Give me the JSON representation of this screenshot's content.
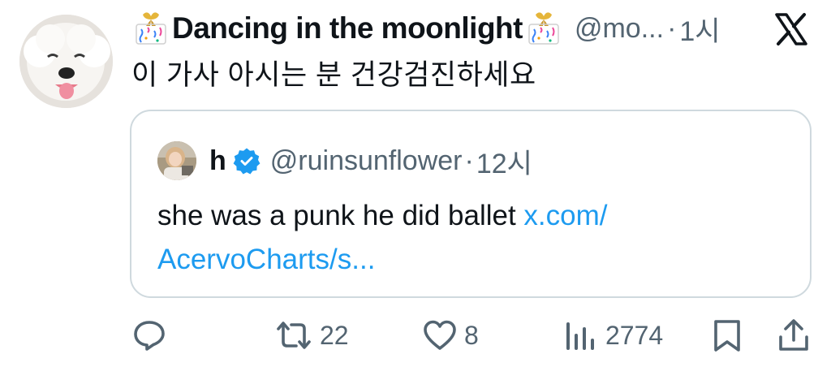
{
  "tweet": {
    "display_name": "Dancing in the moonlight",
    "handle": "@mo...",
    "separator": "·",
    "time": "1시",
    "text": "이 가사 아시는 분 건강검진하세요",
    "name_emoji": "confetti-ribbon-icon"
  },
  "quoted_tweet": {
    "display_name": "h",
    "handle": "@ruinsunflower",
    "separator": "·",
    "time": "12시",
    "text": "she was a punk he did ballet ",
    "link_line1": "x.com/",
    "link_line2": "AcervoCharts/s...",
    "verified": true
  },
  "actions": {
    "reply_icon": "reply-icon",
    "retweet_icon": "retweet-icon",
    "retweet_count": "22",
    "like_icon": "heart-icon",
    "like_count": "8",
    "views_icon": "views-icon",
    "views_count": "2774",
    "bookmark_icon": "bookmark-icon",
    "share_icon": "share-icon"
  },
  "colors": {
    "text": "#0f1419",
    "secondary": "#536471",
    "link": "#1d9bf0",
    "border": "#cfd9de",
    "verified": "#1d9bf0"
  }
}
